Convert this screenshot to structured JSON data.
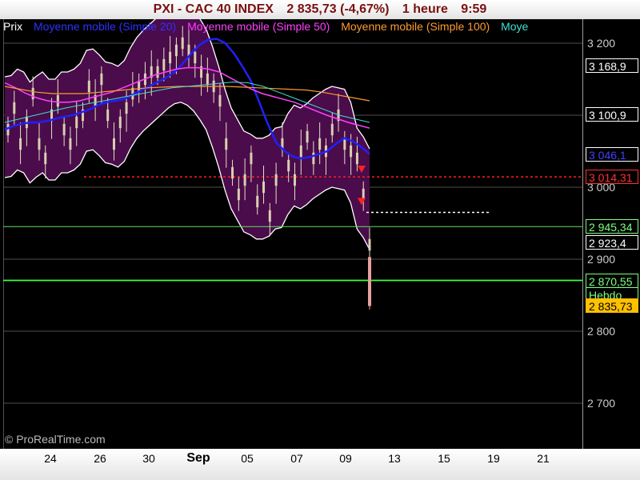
{
  "header": {
    "symbol": "PXI - CAC 40 INDEX",
    "price": "2 835,73 (-4,67%)",
    "period": "1 heure",
    "time": "9:59"
  },
  "legend": [
    {
      "label": "Prix",
      "color": "#ffffff"
    },
    {
      "label": "Moyenne mobile (Simple 20)",
      "color": "#3030ff"
    },
    {
      "label": "Moyenne mobile (Simple 50)",
      "color": "#ff40ff"
    },
    {
      "label": "Moyenne mobile (Simple 100)",
      "color": "#ff9a30"
    },
    {
      "label": "Moye",
      "color": "#40e0d0"
    }
  ],
  "copyright": "© ProRealTime.com",
  "chart_data": {
    "type": "line",
    "x_ticks": [
      "24",
      "26",
      "30",
      "Sep",
      "05",
      "07",
      "09",
      "13",
      "15",
      "19",
      "21"
    ],
    "y_ticks": [
      "3 200",
      "3 100",
      "3 000",
      "2 900",
      "2 800",
      "2 700"
    ],
    "y_tick_values": [
      3200,
      3100,
      3000,
      2900,
      2800,
      2700
    ],
    "ylim": [
      2650,
      3245
    ],
    "price_tags": [
      {
        "text": "3 168,9",
        "value": 3168.9,
        "bg": "#000000",
        "fg": "#ffffff",
        "border": "#ffffff"
      },
      {
        "text": "3 100,9",
        "value": 3100.9,
        "bg": "#000000",
        "fg": "#ffffff",
        "border": "#ffffff"
      },
      {
        "text": "3 046,1",
        "value": 3046.1,
        "bg": "#000000",
        "fg": "#4040ff",
        "border": "#ffffff"
      },
      {
        "text": "3 014,31",
        "value": 3014.31,
        "bg": "#000000",
        "fg": "#ff3030",
        "border": "#ff3030"
      },
      {
        "text": "2 945,34",
        "value": 2945.34,
        "bg": "#000000",
        "fg": "#80ff80",
        "border": "#80ff80"
      },
      {
        "text": "2 923,4",
        "value": 2923.4,
        "bg": "#000000",
        "fg": "#ffffff",
        "border": "#ffffff"
      },
      {
        "text": "2 870,55",
        "value": 2870.55,
        "bg": "#000000",
        "fg": "#80ff80",
        "border": "#80ff80"
      },
      {
        "text": "Hebdo",
        "value": 2851,
        "bg": "#000000",
        "fg": "#80ff80",
        "border": "#80ff80"
      },
      {
        "text": "2 835,73",
        "value": 2835.73,
        "bg": "#ffc000",
        "fg": "#000000",
        "border": "#ffc000"
      }
    ],
    "lines": {
      "support_red": 3014.31,
      "support_green": 2945.34,
      "weekly_green": 2870.55
    },
    "series": [
      {
        "name": "Prix",
        "values": [
          3080,
          3110,
          3060,
          3090,
          3130,
          3060,
          3040,
          3100,
          3120,
          3080,
          3060,
          3090,
          3100,
          3140,
          3120,
          3150,
          3100,
          3060,
          3090,
          3110,
          3130,
          3140,
          3150,
          3160,
          3160,
          3170,
          3180,
          3190,
          3200,
          3190,
          3180,
          3160,
          3150,
          3140,
          3120,
          3060,
          3020,
          2990,
          3010,
          3040,
          2980,
          3000,
          2960,
          3010,
          3060,
          3030,
          3010,
          3050,
          3070,
          3040,
          3060,
          3050,
          3080,
          3100,
          3060,
          3050,
          3040,
          2990,
          2920
        ]
      },
      {
        "name": "Moyenne mobile (Simple 20)",
        "values": [
          3080,
          3085,
          3088,
          3090,
          3090,
          3092,
          3095,
          3098,
          3100,
          3104,
          3108,
          3114,
          3118,
          3120,
          3122,
          3128,
          3134,
          3140,
          3146,
          3152,
          3160,
          3172,
          3186,
          3198,
          3205,
          3206,
          3200,
          3186,
          3168,
          3148,
          3118,
          3088,
          3062,
          3050,
          3042,
          3040,
          3042,
          3046,
          3050,
          3060,
          3068,
          3064,
          3056,
          3046
        ]
      },
      {
        "name": "Moyenne mobile (Simple 50)",
        "values": [
          3145,
          3138,
          3130,
          3124,
          3120,
          3118,
          3118,
          3120,
          3124,
          3128,
          3132,
          3138,
          3144,
          3150,
          3156,
          3160,
          3164,
          3166,
          3166,
          3164,
          3160,
          3152,
          3144,
          3136,
          3130,
          3126,
          3122,
          3118,
          3112,
          3106,
          3100,
          3095,
          3090,
          3086,
          3082
        ]
      },
      {
        "name": "Moyenne mobile (Simple 100)",
        "values": [
          3140,
          3136,
          3132,
          3130,
          3130,
          3130,
          3132,
          3134,
          3136,
          3138,
          3139,
          3140,
          3140,
          3140,
          3140,
          3139,
          3138,
          3137,
          3136,
          3135,
          3132,
          3128,
          3124,
          3120
        ]
      },
      {
        "name": "Moye",
        "values": [
          3090,
          3095,
          3100,
          3105,
          3110,
          3114,
          3118,
          3122,
          3126,
          3130,
          3134,
          3138,
          3140,
          3142,
          3144,
          3146,
          3145,
          3140,
          3132,
          3124,
          3116,
          3108,
          3100,
          3095,
          3090
        ]
      }
    ]
  }
}
